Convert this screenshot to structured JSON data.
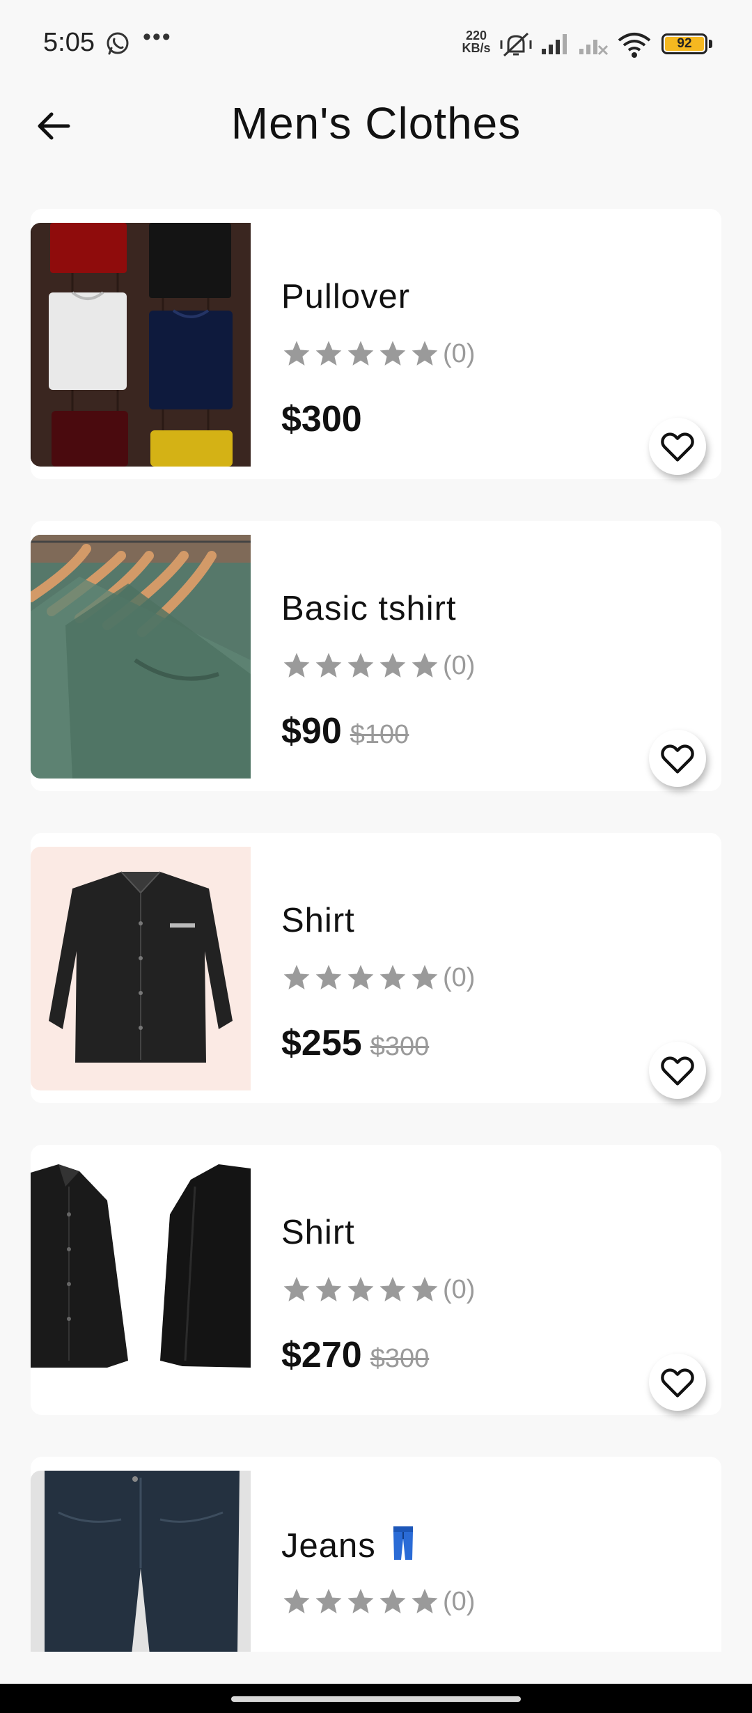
{
  "status_bar": {
    "time": "5:05",
    "net_speed_value": "220",
    "net_speed_unit": "KB/s",
    "battery": "92",
    "icons": [
      "whatsapp-icon",
      "more-icon",
      "mute-vibrate-icon",
      "signal-icon",
      "signal-off-icon",
      "wifi-icon",
      "battery-icon"
    ]
  },
  "header": {
    "title": "Men's Clothes",
    "back_icon": "arrow-left-icon"
  },
  "colors": {
    "background": "#f8f8f8",
    "card": "#ffffff",
    "star": "#9a9a9a",
    "battery": "#f5b820"
  },
  "products": [
    {
      "name": "Pullover",
      "rating_count": "(0)",
      "stars": 0,
      "price": "$300",
      "old_price": "",
      "image": "folded-tshirts-image"
    },
    {
      "name": "Basic tshirt",
      "rating_count": "(0)",
      "stars": 0,
      "price": "$90",
      "old_price": "$100",
      "image": "green-shirts-on-hangers-image"
    },
    {
      "name": "Shirt",
      "rating_count": "(0)",
      "stars": 0,
      "price": "$255",
      "old_price": "$300",
      "image": "black-jacket-image"
    },
    {
      "name": "Shirt",
      "rating_count": "(0)",
      "stars": 0,
      "price": "$270",
      "old_price": "$300",
      "image": "black-shirt-front-back-image"
    },
    {
      "name": "Jeans",
      "rating_count": "(0)",
      "stars": 0,
      "price": "",
      "old_price": "",
      "image": "dark-jeans-image",
      "emoji": "jeans-emoji"
    }
  ]
}
